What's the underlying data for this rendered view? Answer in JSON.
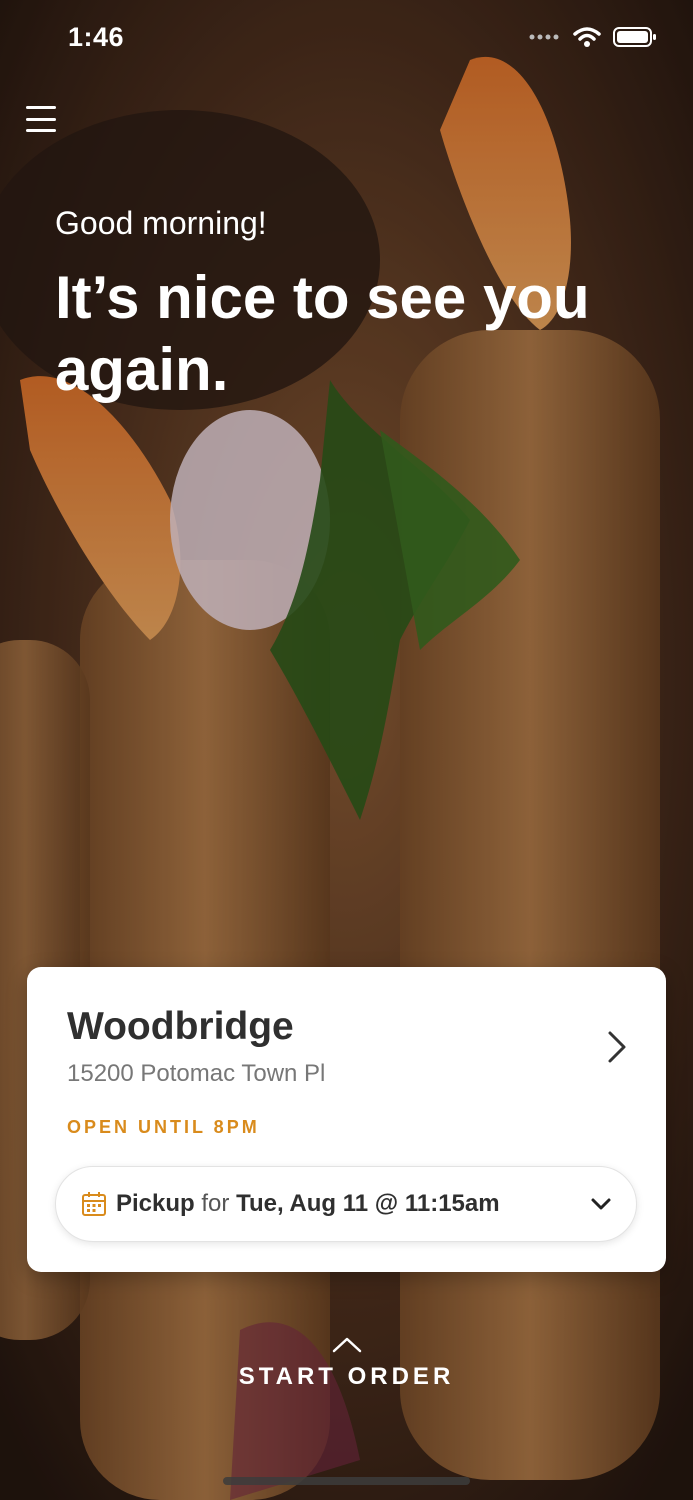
{
  "status_bar": {
    "time": "1:46"
  },
  "hero": {
    "greeting": "Good morning!",
    "headline": "It’s nice to see you again."
  },
  "location_card": {
    "store_name": "Woodbridge",
    "address": "15200 Potomac Town Pl",
    "hours_status": "OPEN UNTIL 8PM",
    "pickup": {
      "method": "Pickup",
      "connector": "for",
      "datetime": "Tue, Aug 11 @ 11:15am"
    }
  },
  "cta": {
    "label": "START ORDER"
  },
  "colors": {
    "accent": "#d98b1c",
    "card_bg": "#ffffff",
    "text_dark": "#2f2f2f"
  },
  "icons": [
    "menu-icon",
    "wifi-icon",
    "battery-icon",
    "chevron-right-icon",
    "calendar-icon",
    "chevron-down-icon",
    "chevron-up-icon"
  ]
}
